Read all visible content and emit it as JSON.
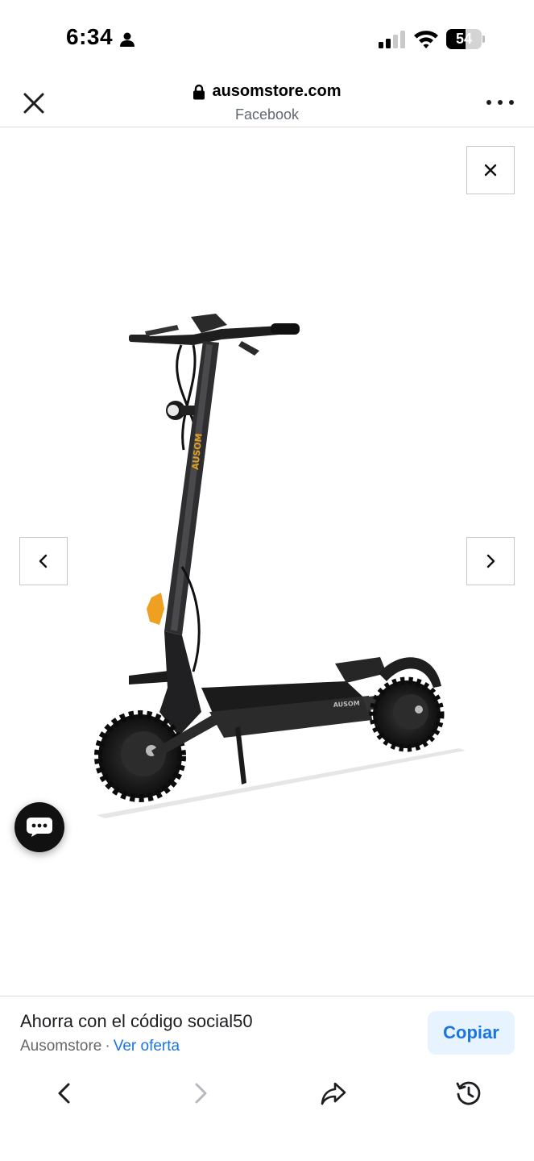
{
  "status_bar": {
    "time": "6:34",
    "battery_level": "54",
    "battery_fraction": 0.54
  },
  "browser": {
    "domain": "ausomstore.com",
    "source": "Facebook",
    "icons": [
      "close-icon",
      "lock-icon",
      "more-icon"
    ]
  },
  "viewer": {
    "icons": [
      "close-icon",
      "chevron-left-icon",
      "chevron-right-icon",
      "chat-bubble-icon"
    ]
  },
  "offer": {
    "title": "Ahorra con el código social50",
    "advertiser": "Ausomstore",
    "separator": "·",
    "link_label": "Ver oferta",
    "copy_label": "Copiar"
  },
  "toolbar": {
    "icons": [
      "back-icon",
      "forward-icon",
      "share-icon",
      "history-icon"
    ],
    "forward_enabled": false
  },
  "colors": {
    "link": "#1b74e4",
    "copy_button_bg": "#e7f3ff",
    "muted_text": "#65676b",
    "scooter_accent": "#f0a020"
  }
}
